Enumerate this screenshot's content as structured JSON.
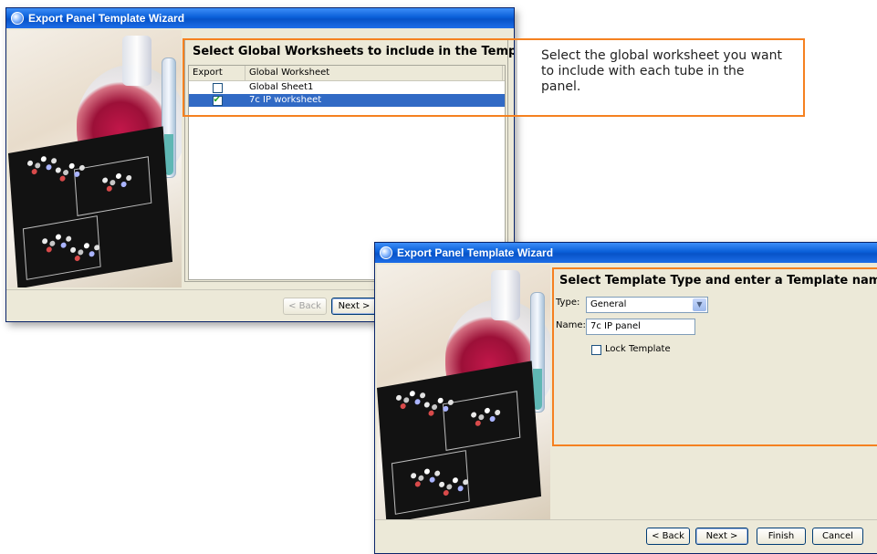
{
  "window1": {
    "title": "Export Panel Template Wizard",
    "heading": "Select Global Worksheets to include in the Template",
    "columns": [
      "Export",
      "Global Worksheet"
    ],
    "rows": [
      {
        "name": "Global Sheet1",
        "checked": false,
        "selected": false
      },
      {
        "name": "7c IP worksheet",
        "checked": true,
        "selected": true
      }
    ],
    "buttons": {
      "back": "< Back",
      "next": "Next >"
    }
  },
  "window2": {
    "title": "Export Panel Template Wizard",
    "heading": "Select Template Type and enter a Template name",
    "type_label": "Type:",
    "type_value": "General",
    "name_label": "Name:",
    "name_value": "7c IP panel",
    "lock_label": "Lock Template",
    "lock_checked": false,
    "buttons": {
      "back": "< Back",
      "next": "Next >",
      "finish": "Finish",
      "cancel": "Cancel"
    }
  },
  "callout": {
    "text": "Select the global worksheet you want to include with each tube in the panel.",
    "color": "#f58120"
  },
  "icons": [
    "app-icon",
    "checkbox-checked",
    "checkbox-unchecked",
    "dropdown-arrow-icon"
  ]
}
